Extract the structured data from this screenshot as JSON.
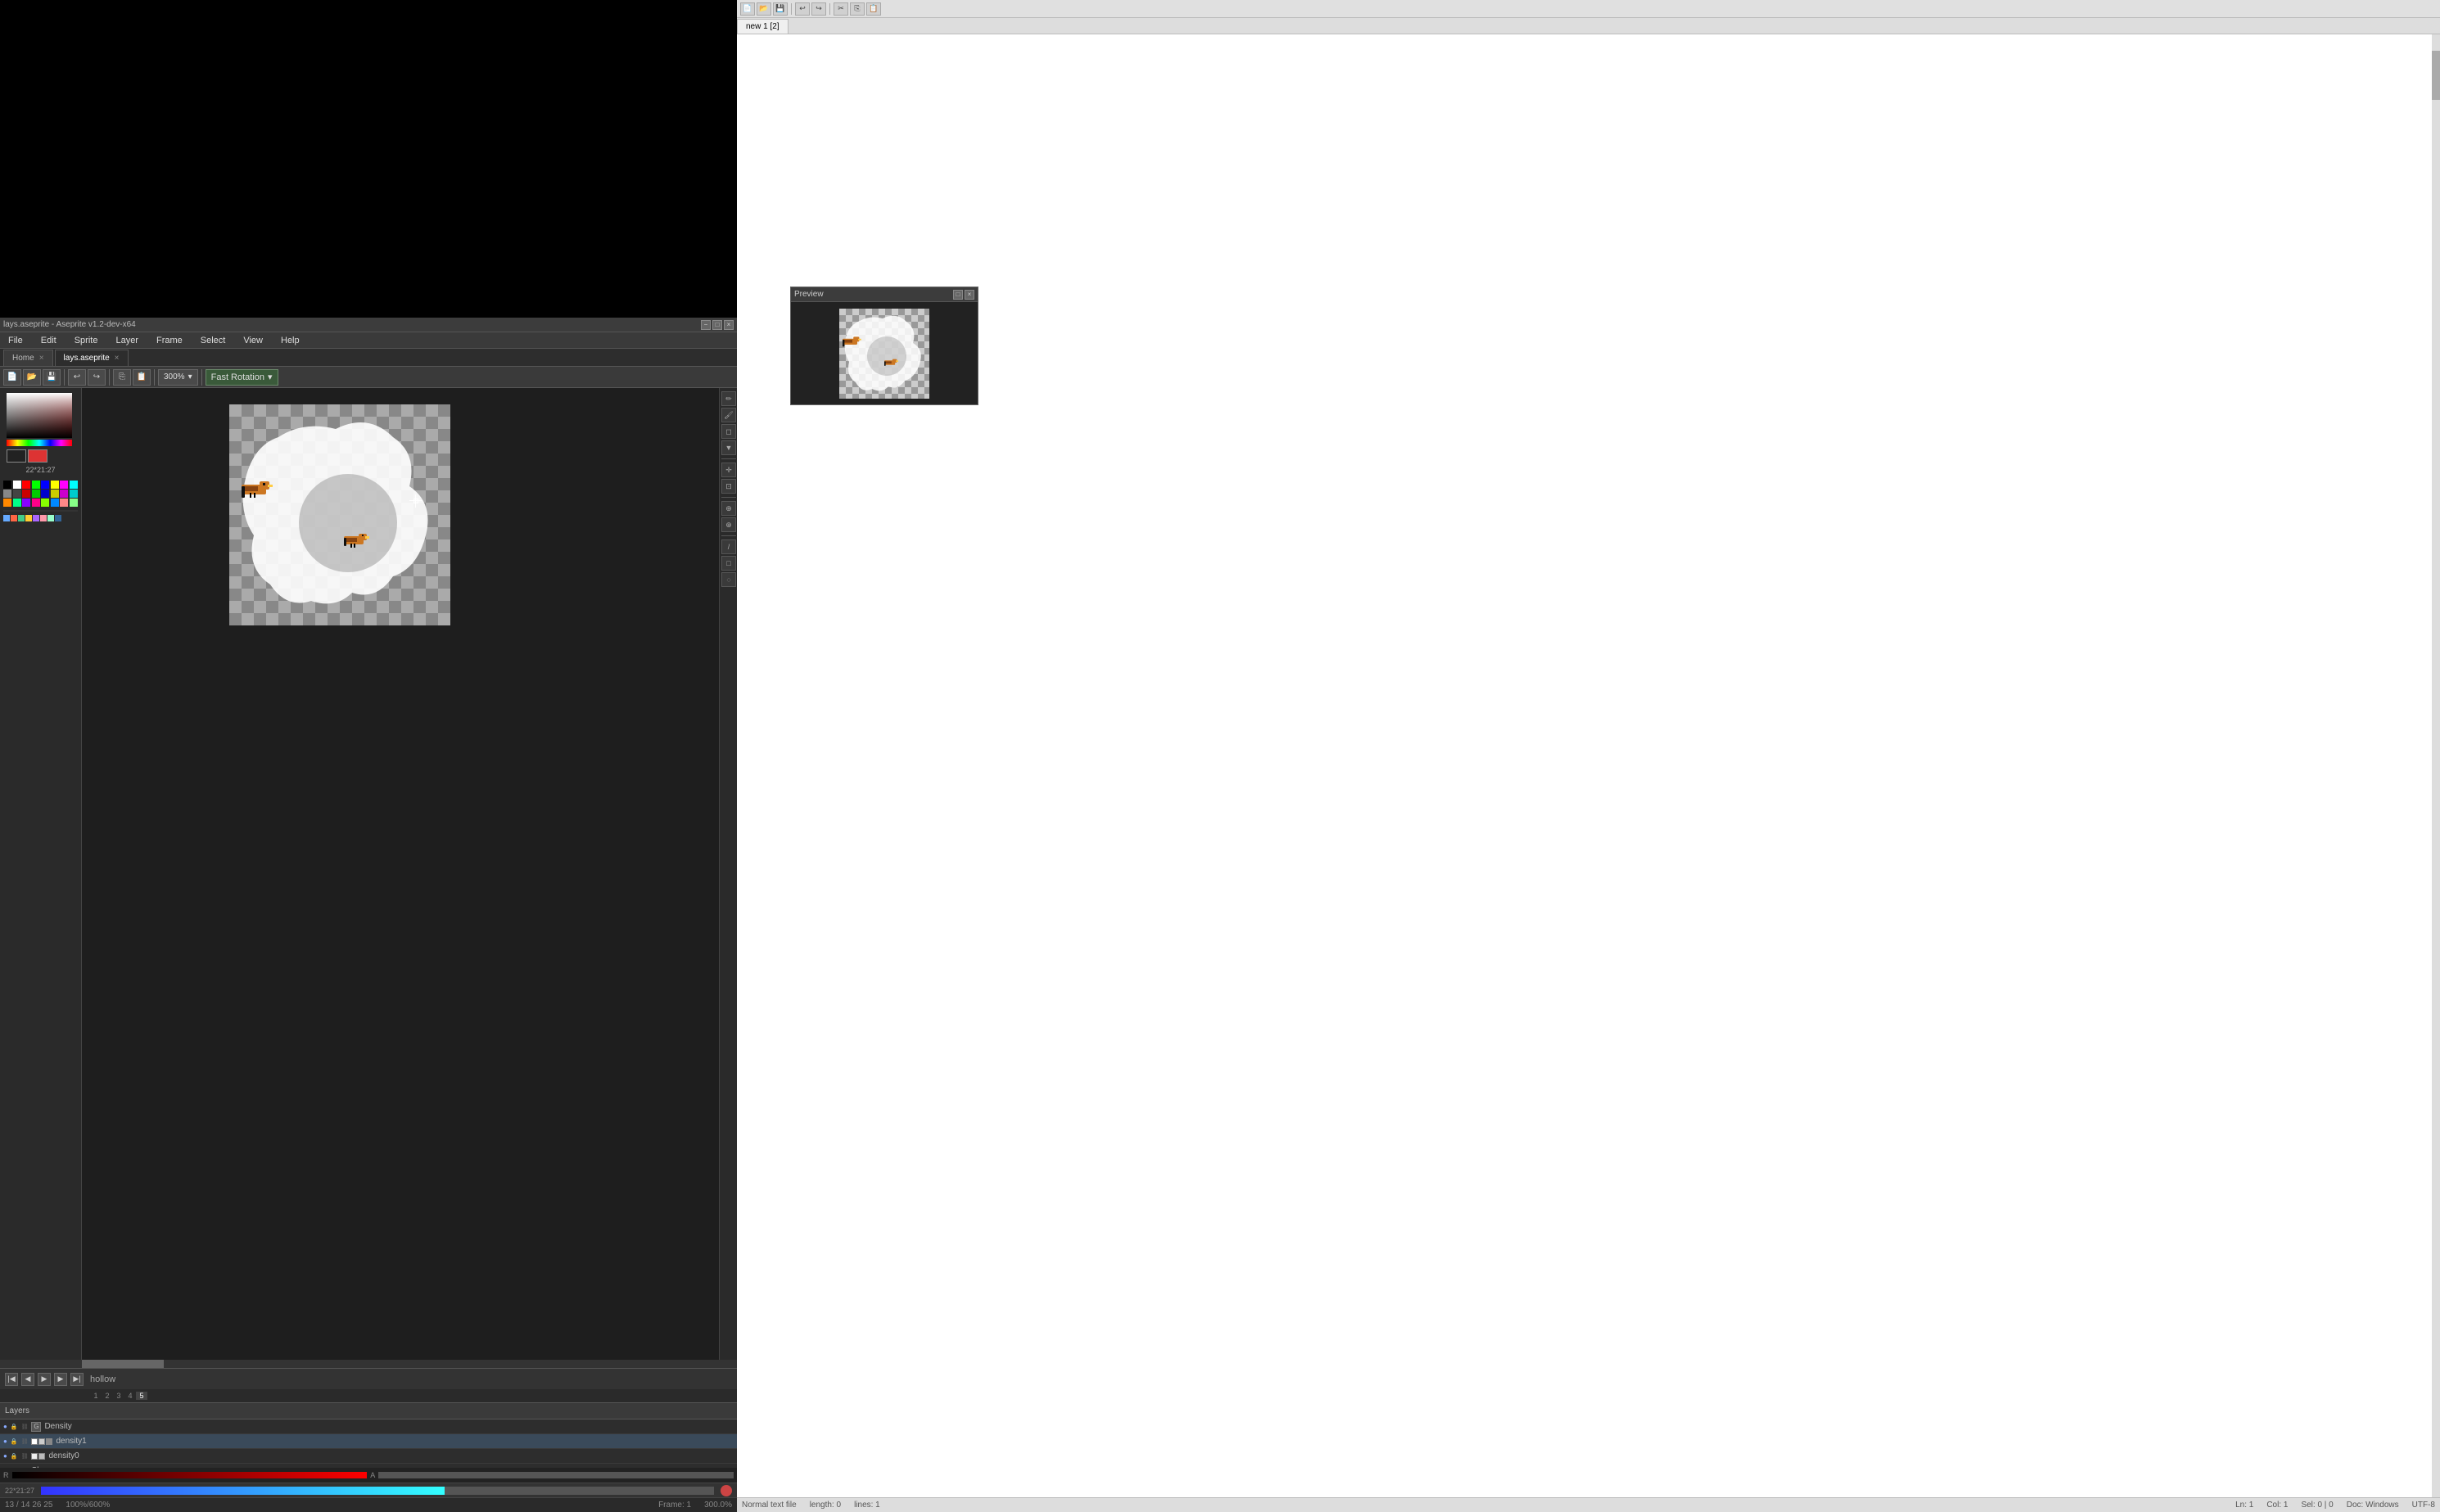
{
  "app": {
    "title": "lays.aseprite - Aseprite v1.2-dev-x64",
    "titlebar_label": "lays.aseprite - Aseprite v1.2-dev-x64"
  },
  "titlebar": {
    "close": "×",
    "minimize": "−",
    "maximize": "□"
  },
  "menu": {
    "items": [
      "File",
      "Edit",
      "Sprite",
      "Layer",
      "Frame",
      "Select",
      "View",
      "Help"
    ]
  },
  "tabs": {
    "home": {
      "label": "Home",
      "active": false
    },
    "lays": {
      "label": "lays.aseprite",
      "active": true
    }
  },
  "toolbar": {
    "zoom_label": "300%",
    "rotation_label": "Fast Rotation",
    "rotation_icon": "▾"
  },
  "palette": {
    "colors": [
      "#000000",
      "#ffffff",
      "#ff0000",
      "#00ff00",
      "#0000ff",
      "#ffff00",
      "#ff00ff",
      "#00ffff",
      "#888888",
      "#444444",
      "#cc0000",
      "#00cc00",
      "#0000cc",
      "#cccc00",
      "#cc00cc",
      "#00cccc",
      "#ff8800",
      "#00ff88",
      "#8800ff",
      "#ff0088",
      "#88ff00",
      "#0088ff",
      "#ff8888",
      "#88ff88"
    ]
  },
  "color": {
    "fg": "#222222",
    "bg": "#ff4444",
    "hex_value": "22*21:27"
  },
  "layers": {
    "header": "Layers",
    "items": [
      {
        "name": "Density",
        "type": "group",
        "visible": true,
        "locked": false
      },
      {
        "name": "density1",
        "type": "layer",
        "visible": true,
        "locked": false,
        "selected": true
      },
      {
        "name": "density0",
        "type": "layer",
        "visible": true,
        "locked": false
      },
      {
        "name": "Shape",
        "type": "layer",
        "visible": true,
        "locked": false
      }
    ]
  },
  "animation": {
    "play_btn": "▶",
    "stop_btn": "■",
    "prev_btn": "◀",
    "next_btn": "▶",
    "first_btn": "|◀",
    "last_btn": "▶|",
    "loop_label": "hollow",
    "frame_label": "Frame:",
    "frame_value": "1",
    "fps_label": "300.0%"
  },
  "frame_numbers": [
    "1",
    "2",
    "3",
    "4",
    "5"
  ],
  "status": {
    "coords": "13 / 14  26  25",
    "length": "length: 0",
    "lines": "lines: 1",
    "ln": "Ln: 1",
    "col": "Col: 1",
    "sel": "Sel: 0 | 0",
    "doc_type": "Doc: Windows",
    "encoding": "UTF-8",
    "zoom": "100%/600%",
    "file_type": "Normal text file"
  },
  "preview": {
    "title": "Preview",
    "controls": [
      "□",
      "×"
    ]
  },
  "editor": {
    "tab_label": "new 1 [2]"
  },
  "icons": {
    "eye": "●",
    "lock": "🔒",
    "chain": "⛓",
    "pencil": "✏",
    "eraser": "◻",
    "bucket": "▼",
    "eyedropper": "⊕",
    "select": "⊡",
    "move": "✛",
    "zoom_in": "+",
    "zoom_out": "−",
    "chevron_down": "▾"
  }
}
